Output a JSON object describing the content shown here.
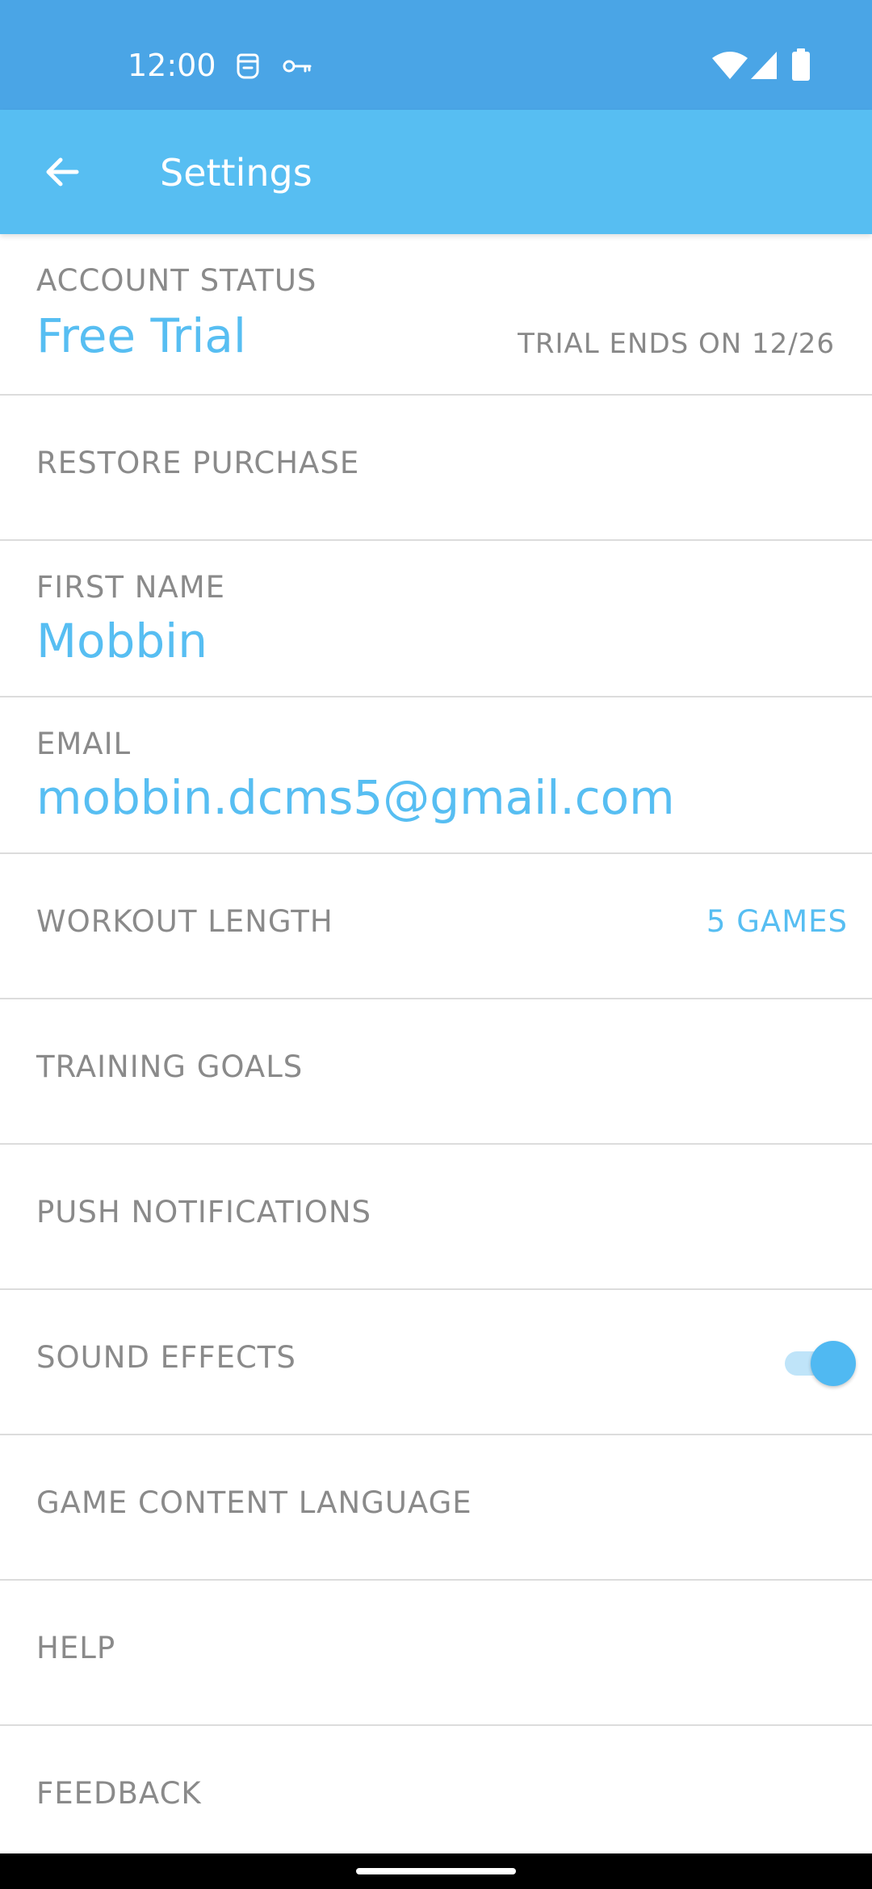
{
  "status_bar": {
    "time": "12:00",
    "icons": [
      "sim-icon",
      "key-icon",
      "wifi-icon",
      "signal-icon",
      "battery-icon"
    ]
  },
  "app_bar": {
    "title": "Settings",
    "back_icon": "back-arrow-icon"
  },
  "settings": {
    "account_status": {
      "label": "ACCOUNT STATUS",
      "value": "Free Trial",
      "trial_info": "TRIAL ENDS ON 12/26"
    },
    "restore_purchase": {
      "label": "RESTORE PURCHASE"
    },
    "first_name": {
      "label": "FIRST NAME",
      "value": "Mobbin"
    },
    "email": {
      "label": "EMAIL",
      "value": "mobbin.dcms5@gmail.com"
    },
    "workout_length": {
      "label": "WORKOUT LENGTH",
      "value": "5 GAMES"
    },
    "training_goals": {
      "label": "TRAINING GOALS"
    },
    "push_notifications": {
      "label": "PUSH NOTIFICATIONS"
    },
    "sound_effects": {
      "label": "SOUND EFFECTS",
      "enabled": true
    },
    "game_content_language": {
      "label": "GAME CONTENT LANGUAGE"
    },
    "help": {
      "label": "HELP"
    },
    "feedback": {
      "label": "FEEDBACK"
    }
  },
  "colors": {
    "status_bar": "#4aa5e6",
    "app_bar": "#57bef2",
    "accent": "#57bef2",
    "label_gray": "#8a8a8a",
    "divider": "#dcdcdc"
  }
}
